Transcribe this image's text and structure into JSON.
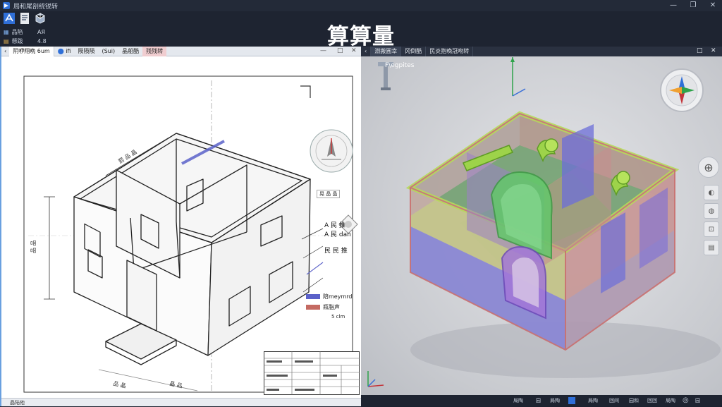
{
  "window": {
    "title": "局和尾剖统锐转",
    "minimize": "—",
    "restore": "❐",
    "close": "✕"
  },
  "headline": "算算量",
  "toolbar": {
    "row1_label": "品陷",
    "row1_value": "AЯ",
    "row2_label": "懸跋",
    "row2_value": "4.8"
  },
  "left_panel": {
    "tabs": [
      "阴咿翔晩 6um",
      "ifi",
      "陨陨陨",
      "(Sui)",
      "晶船酷",
      "残残转"
    ],
    "controls": [
      "—",
      "□",
      "✕"
    ],
    "status": "晶陆他",
    "legend": [
      {
        "label": "陪meymrd",
        "color": "#5b62c9"
      },
      {
        "label": "瓶脂声",
        "color": "#c46a62"
      }
    ],
    "legend_note": "5 clm",
    "callouts": [
      "A 民 推",
      "A 民 dan",
      "民 民 推"
    ],
    "view_label": "晃 晶 晶"
  },
  "right_panel": {
    "tabs": [
      "淵搬圓幸",
      "冈倒酷",
      "民炎抱晚冠吻转"
    ],
    "controls": [
      "□",
      "✕"
    ],
    "model_label": "F\\egpites",
    "side_buttons": [
      "⊕",
      "◐",
      "◍",
      "⊡",
      "▤"
    ],
    "status_items": [
      "局陶",
      "园",
      "局陶",
      "局陶",
      "回间",
      "园和",
      "回回",
      "局陶",
      "园"
    ]
  }
}
